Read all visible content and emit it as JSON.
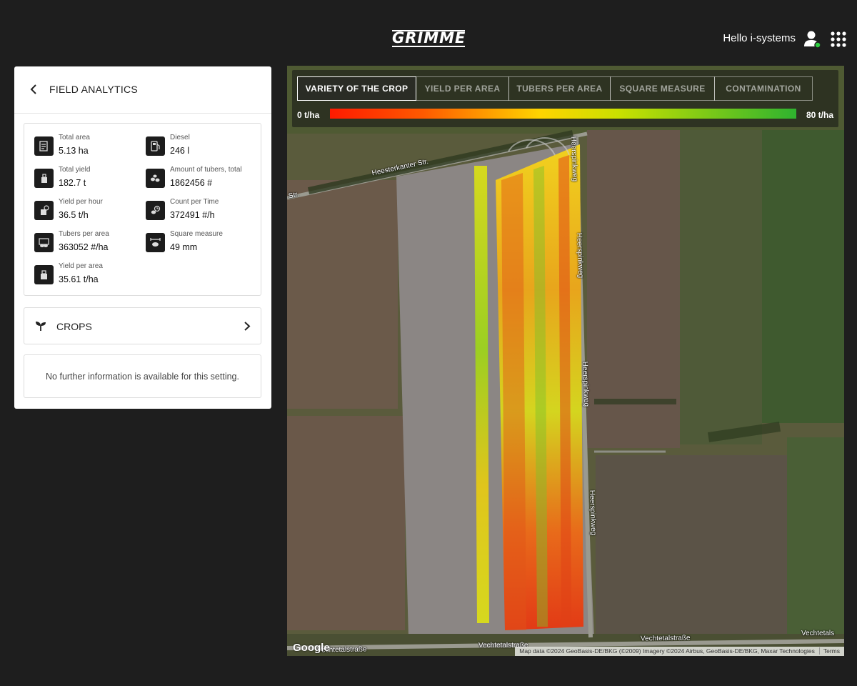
{
  "header": {
    "logo_text": "GRIMME",
    "greeting": "Hello i-systems",
    "user_icon": "user-icon",
    "apps_icon": "apps-grid-icon",
    "online_color": "#2ecc40"
  },
  "panel": {
    "title": "FIELD ANALYTICS",
    "stats": [
      {
        "label": "Total area",
        "value": "5.13 ha",
        "icon": "area-icon"
      },
      {
        "label": "Diesel",
        "value": "246 l",
        "icon": "fuel-icon"
      },
      {
        "label": "Total yield",
        "value": "182.7 t",
        "icon": "yield-icon"
      },
      {
        "label": "Amount of tubers, total",
        "value": "1862456 #",
        "icon": "tubers-icon"
      },
      {
        "label": "Yield per hour",
        "value": "36.5 t/h",
        "icon": "yield-hour-icon"
      },
      {
        "label": "Count per Time",
        "value": "372491 #/h",
        "icon": "count-time-icon"
      },
      {
        "label": "Tubers per area",
        "value": "363052 #/ha",
        "icon": "tubers-area-icon"
      },
      {
        "label": "Square measure",
        "value": "49 mm",
        "icon": "square-measure-icon"
      },
      {
        "label": "Yield per area",
        "value": "35.61 t/ha",
        "icon": "yield-area-icon"
      }
    ],
    "crops_label": "CROPS",
    "info_text": "No further information is available for this setting."
  },
  "map": {
    "tabs": [
      {
        "label": "VARIETY OF THE CROP",
        "active": true
      },
      {
        "label": "YIELD PER AREA",
        "active": false
      },
      {
        "label": "TUBERS PER AREA",
        "active": false
      },
      {
        "label": "SQUARE MEASURE",
        "active": false
      },
      {
        "label": "CONTAMINATION",
        "active": false
      }
    ],
    "scale_min": "0 t/ha",
    "scale_max": "80 t/ha",
    "scale_colors": [
      "#ff1a00",
      "#ffd400",
      "#2fb32f"
    ],
    "roads": [
      "Heesterkanter Str.",
      "Str.",
      "Heerspinkweg",
      "Heerspinkweg",
      "Heerspinkweg",
      "Heerspinkweg",
      "Vechtetalstraße",
      "Vechtetalstraße",
      "Vechtetalstraße",
      "Vechtetals"
    ],
    "google_logo": "Google",
    "attribution": "Map data ©2024 GeoBasis-DE/BKG (©2009) Imagery ©2024 Airbus, GeoBasis-DE/BKG, Maxar Technologies",
    "terms": "Terms"
  }
}
